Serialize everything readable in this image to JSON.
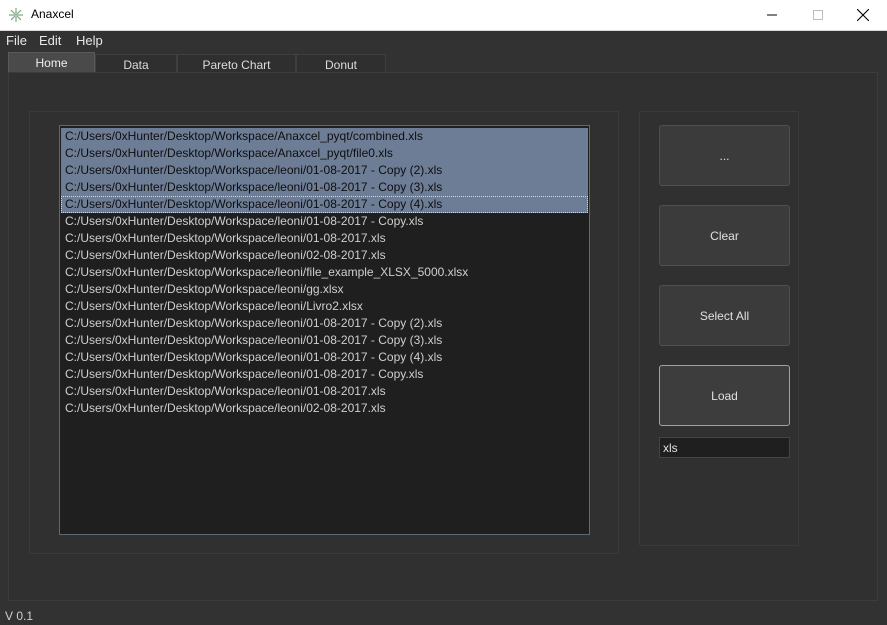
{
  "window": {
    "title": "Anaxcel"
  },
  "menu": {
    "file": "File",
    "edit": "Edit",
    "help": "Help"
  },
  "tabs": [
    {
      "label": "Home",
      "active": true
    },
    {
      "label": "Data",
      "active": false
    },
    {
      "label": "Pareto Chart",
      "active": false
    },
    {
      "label": "Donut",
      "active": false
    }
  ],
  "file_list": {
    "items": [
      {
        "path": "C:/Users/0xHunter/Desktop/Workspace/Anaxcel_pyqt/combined.xls",
        "selected": true
      },
      {
        "path": "C:/Users/0xHunter/Desktop/Workspace/Anaxcel_pyqt/file0.xls",
        "selected": true
      },
      {
        "path": "C:/Users/0xHunter/Desktop/Workspace/leoni/01-08-2017 - Copy (2).xls",
        "selected": true
      },
      {
        "path": "C:/Users/0xHunter/Desktop/Workspace/leoni/01-08-2017 - Copy (3).xls",
        "selected": true
      },
      {
        "path": "C:/Users/0xHunter/Desktop/Workspace/leoni/01-08-2017 - Copy (4).xls",
        "selected": true,
        "current": true
      },
      {
        "path": "C:/Users/0xHunter/Desktop/Workspace/leoni/01-08-2017 - Copy.xls",
        "selected": false
      },
      {
        "path": "C:/Users/0xHunter/Desktop/Workspace/leoni/01-08-2017.xls",
        "selected": false
      },
      {
        "path": "C:/Users/0xHunter/Desktop/Workspace/leoni/02-08-2017.xls",
        "selected": false
      },
      {
        "path": "C:/Users/0xHunter/Desktop/Workspace/leoni/file_example_XLSX_5000.xlsx",
        "selected": false
      },
      {
        "path": "C:/Users/0xHunter/Desktop/Workspace/leoni/gg.xlsx",
        "selected": false
      },
      {
        "path": "C:/Users/0xHunter/Desktop/Workspace/leoni/Livro2.xlsx",
        "selected": false
      },
      {
        "path": "C:/Users/0xHunter/Desktop/Workspace/leoni/01-08-2017 - Copy (2).xls",
        "selected": false
      },
      {
        "path": "C:/Users/0xHunter/Desktop/Workspace/leoni/01-08-2017 - Copy (3).xls",
        "selected": false
      },
      {
        "path": "C:/Users/0xHunter/Desktop/Workspace/leoni/01-08-2017 - Copy (4).xls",
        "selected": false
      },
      {
        "path": "C:/Users/0xHunter/Desktop/Workspace/leoni/01-08-2017 - Copy.xls",
        "selected": false
      },
      {
        "path": "C:/Users/0xHunter/Desktop/Workspace/leoni/01-08-2017.xls",
        "selected": false
      },
      {
        "path": "C:/Users/0xHunter/Desktop/Workspace/leoni/02-08-2017.xls",
        "selected": false
      }
    ]
  },
  "buttons": {
    "browse": "...",
    "clear": "Clear",
    "select_all": "Select All",
    "load": "Load"
  },
  "extension_filter": {
    "value": "xls"
  },
  "status": {
    "version": "V 0.1"
  },
  "colors": {
    "background": "#323232",
    "selection": "#6d7d96",
    "list_background": "#1f1f1f"
  },
  "icons": {
    "app": "anaxcel-app-icon",
    "minimize": "minimize-icon",
    "maximize": "maximize-icon",
    "close": "close-icon"
  }
}
